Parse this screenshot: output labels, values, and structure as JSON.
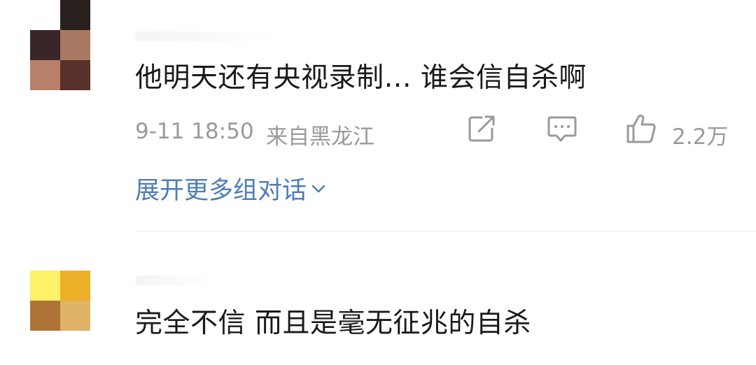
{
  "comments": [
    {
      "text": "他明天还有央视录制‥. 谁会信自杀啊",
      "time": "9-11 18:50",
      "location": "来自黑龙江",
      "like_count": "2.2万",
      "expand_label": "展开更多组对话",
      "icons": [
        "share-icon",
        "comment-icon",
        "like-icon",
        "chevron-down-icon"
      ],
      "avatar_colors": [
        "#3a2528",
        "#a87a64",
        "#b88068",
        "#5a302a"
      ]
    },
    {
      "text": "完全不信 而且是毫无征兆的自杀",
      "avatar_colors": [
        "#fdf167",
        "#eab028",
        "#ad7235",
        "#dfb368"
      ]
    }
  ],
  "colors": {
    "meta": "#9a9a9a",
    "link": "#4d7db6",
    "text": "#1a1a1a",
    "divider": "#e8e8e8"
  }
}
